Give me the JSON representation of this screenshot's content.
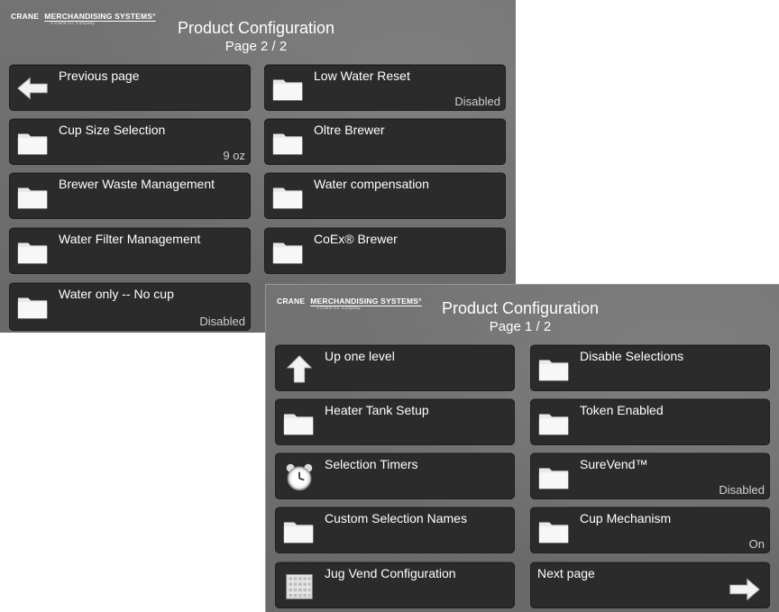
{
  "page2": {
    "brand": {
      "crane": "CRANE",
      "merch": "MERCHANDISING SYSTEMS°",
      "tagline": "A Crane Co. Company"
    },
    "title": "Product Configuration",
    "page": "Page 2 / 2",
    "items": [
      {
        "label": "Previous page",
        "value": ""
      },
      {
        "label": "Low Water Reset",
        "value": "Disabled"
      },
      {
        "label": "Cup Size Selection",
        "value": "9 oz"
      },
      {
        "label": "Oltre Brewer",
        "value": ""
      },
      {
        "label": "Brewer Waste Management",
        "value": ""
      },
      {
        "label": "Water compensation",
        "value": ""
      },
      {
        "label": "Water Filter Management",
        "value": ""
      },
      {
        "label": "CoEx® Brewer",
        "value": ""
      },
      {
        "label": "Water only -- No cup",
        "value": "Disabled"
      }
    ]
  },
  "page1": {
    "brand": {
      "crane": "CRANE",
      "merch": "MERCHANDISING SYSTEMS°",
      "tagline": "A Crane Co. Company"
    },
    "title": "Product Configuration",
    "page": "Page 1 / 2",
    "items": [
      {
        "label": "Up one level",
        "value": ""
      },
      {
        "label": "Disable Selections",
        "value": ""
      },
      {
        "label": "Heater Tank Setup",
        "value": ""
      },
      {
        "label": "Token Enabled",
        "value": ""
      },
      {
        "label": "Selection Timers",
        "value": ""
      },
      {
        "label": "SureVend™",
        "value": "Disabled"
      },
      {
        "label": "Custom Selection Names",
        "value": ""
      },
      {
        "label": "Cup Mechanism",
        "value": "On"
      },
      {
        "label": "Jug Vend Configuration",
        "value": ""
      },
      {
        "label": "Next page",
        "value": ""
      }
    ]
  }
}
